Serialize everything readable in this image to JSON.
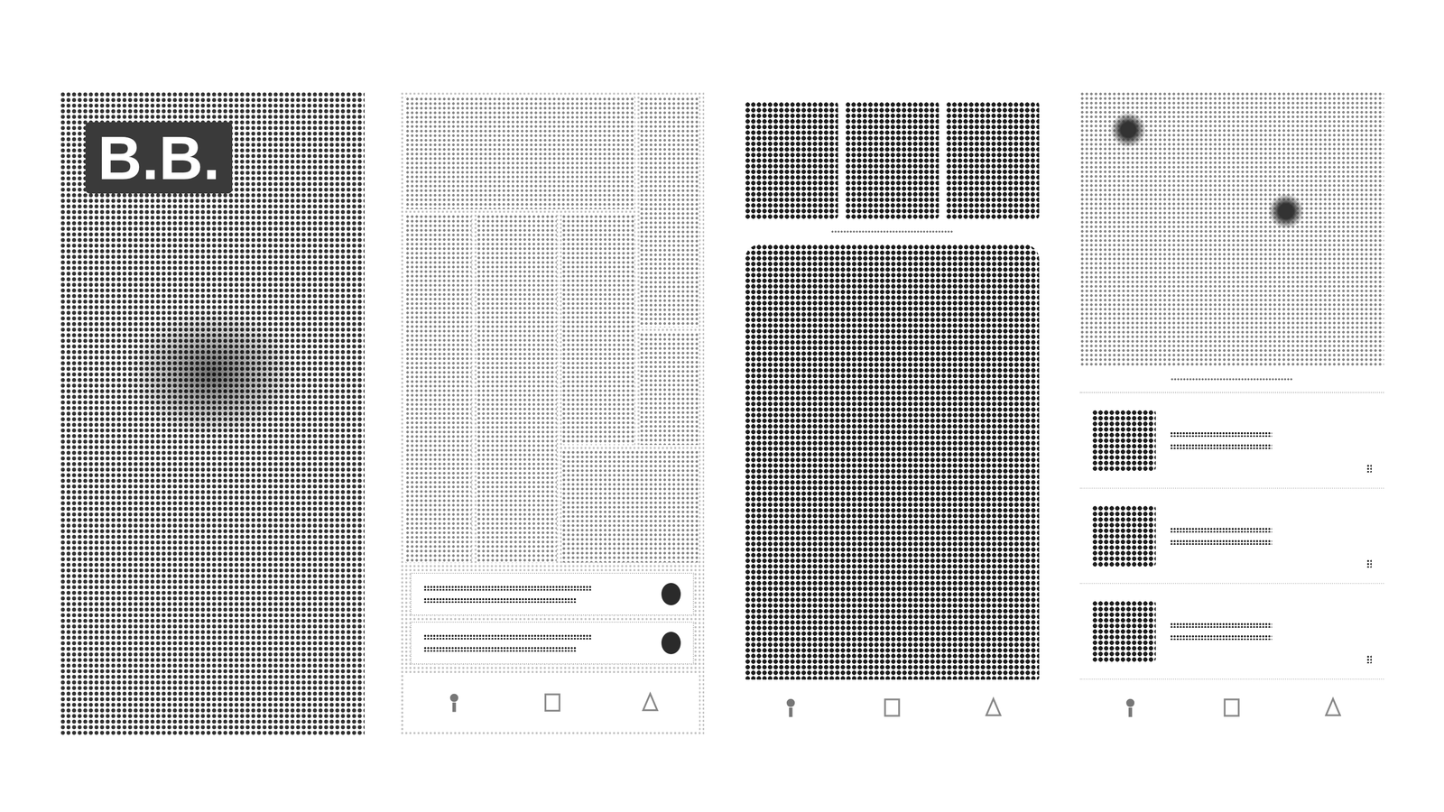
{
  "screens": [
    {
      "kind": "splash",
      "logo": "B.B."
    },
    {
      "kind": "grid"
    },
    {
      "kind": "gallery"
    },
    {
      "kind": "list"
    }
  ]
}
